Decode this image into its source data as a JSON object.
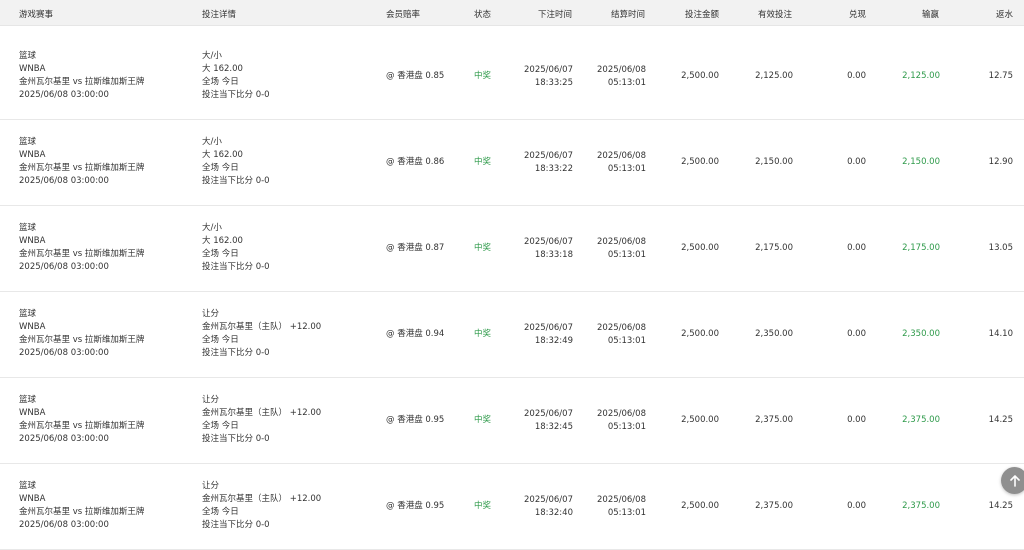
{
  "table": {
    "headers": [
      "游戏赛事",
      "投注详情",
      "会员赔率",
      "状态",
      "下注时间",
      "结算时间",
      "投注金额",
      "有效投注",
      "兑现",
      "输赢",
      "返水"
    ],
    "rows": [
      {
        "event": [
          "篮球",
          "WNBA",
          "金州瓦尔基里 vs 拉斯维加斯王牌",
          "2025/06/08 03:00:00"
        ],
        "detail": [
          "大/小",
          "大 162.00",
          "全场 今日",
          "投注当下比分 0-0"
        ],
        "odds": "@ 香港盘 0.85",
        "status": "中奖",
        "bet_time": [
          "2025/06/07",
          "18:33:25"
        ],
        "settle_time": [
          "2025/06/08",
          "05:13:01"
        ],
        "amount": "2,500.00",
        "valid": "2,125.00",
        "cashout": "0.00",
        "winloss": "2,125.00",
        "rebate": "12.75"
      },
      {
        "event": [
          "篮球",
          "WNBA",
          "金州瓦尔基里 vs 拉斯维加斯王牌",
          "2025/06/08 03:00:00"
        ],
        "detail": [
          "大/小",
          "大 162.00",
          "全场 今日",
          "投注当下比分 0-0"
        ],
        "odds": "@ 香港盘 0.86",
        "status": "中奖",
        "bet_time": [
          "2025/06/07",
          "18:33:22"
        ],
        "settle_time": [
          "2025/06/08",
          "05:13:01"
        ],
        "amount": "2,500.00",
        "valid": "2,150.00",
        "cashout": "0.00",
        "winloss": "2,150.00",
        "rebate": "12.90"
      },
      {
        "event": [
          "篮球",
          "WNBA",
          "金州瓦尔基里 vs 拉斯维加斯王牌",
          "2025/06/08 03:00:00"
        ],
        "detail": [
          "大/小",
          "大 162.00",
          "全场 今日",
          "投注当下比分 0-0"
        ],
        "odds": "@ 香港盘 0.87",
        "status": "中奖",
        "bet_time": [
          "2025/06/07",
          "18:33:18"
        ],
        "settle_time": [
          "2025/06/08",
          "05:13:01"
        ],
        "amount": "2,500.00",
        "valid": "2,175.00",
        "cashout": "0.00",
        "winloss": "2,175.00",
        "rebate": "13.05"
      },
      {
        "event": [
          "篮球",
          "WNBA",
          "金州瓦尔基里 vs 拉斯维加斯王牌",
          "2025/06/08 03:00:00"
        ],
        "detail": [
          "让分",
          "金州瓦尔基里（主队） +12.00",
          "全场 今日",
          "投注当下比分 0-0"
        ],
        "odds": "@ 香港盘 0.94",
        "status": "中奖",
        "bet_time": [
          "2025/06/07",
          "18:32:49"
        ],
        "settle_time": [
          "2025/06/08",
          "05:13:01"
        ],
        "amount": "2,500.00",
        "valid": "2,350.00",
        "cashout": "0.00",
        "winloss": "2,350.00",
        "rebate": "14.10"
      },
      {
        "event": [
          "篮球",
          "WNBA",
          "金州瓦尔基里 vs 拉斯维加斯王牌",
          "2025/06/08 03:00:00"
        ],
        "detail": [
          "让分",
          "金州瓦尔基里（主队） +12.00",
          "全场 今日",
          "投注当下比分 0-0"
        ],
        "odds": "@ 香港盘 0.95",
        "status": "中奖",
        "bet_time": [
          "2025/06/07",
          "18:32:45"
        ],
        "settle_time": [
          "2025/06/08",
          "05:13:01"
        ],
        "amount": "2,500.00",
        "valid": "2,375.00",
        "cashout": "0.00",
        "winloss": "2,375.00",
        "rebate": "14.25"
      },
      {
        "event": [
          "篮球",
          "WNBA",
          "金州瓦尔基里 vs 拉斯维加斯王牌",
          "2025/06/08 03:00:00"
        ],
        "detail": [
          "让分",
          "金州瓦尔基里（主队） +12.00",
          "全场 今日",
          "投注当下比分 0-0"
        ],
        "odds": "@ 香港盘 0.95",
        "status": "中奖",
        "bet_time": [
          "2025/06/07",
          "18:32:40"
        ],
        "settle_time": [
          "2025/06/08",
          "05:13:01"
        ],
        "amount": "2,500.00",
        "valid": "2,375.00",
        "cashout": "0.00",
        "winloss": "2,375.00",
        "rebate": "14.25"
      }
    ]
  },
  "scroll_top": {
    "icon": "arrow-up-icon"
  },
  "colors": {
    "win": "#2e9a4a",
    "header_bg": "#f2f2f2",
    "scroll_button": "#8f8f8f"
  }
}
